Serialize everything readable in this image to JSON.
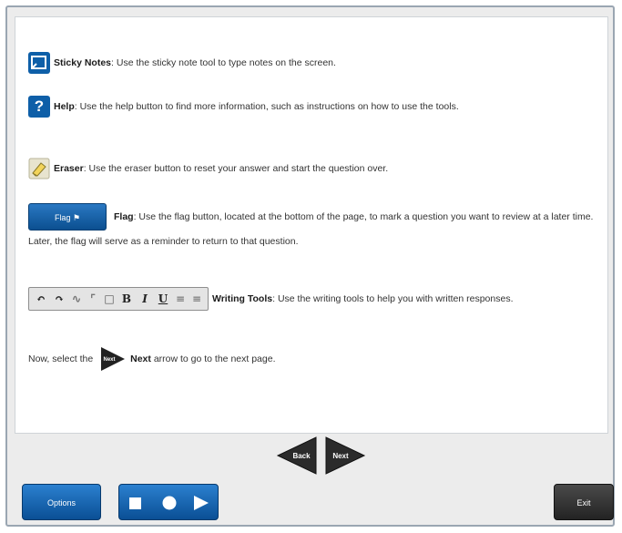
{
  "instructions": {
    "sticky": {
      "title": "Sticky Notes",
      "text": ": Use the sticky note tool to type notes on the screen."
    },
    "help": {
      "icon_label": "?",
      "title": "Help",
      "text": ": Use the help button to find more information, such as instructions on how to use the tools."
    },
    "eraser": {
      "title": "Eraser",
      "text": ": Use the eraser button to reset your answer and start the question over."
    },
    "flag": {
      "button_label": "Flag",
      "title": "Flag",
      "text": ": Use the flag button, located at the bottom of the page, to mark a question you want to review at a later time. Later, the flag will serve as a reminder to return to that question."
    },
    "writing": {
      "title": "Writing Tools",
      "text": ": Use the writing tools to help you with written responses.",
      "tools": [
        "undo",
        "redo",
        "B",
        "I",
        "U"
      ]
    },
    "next": {
      "before": "Now, select the",
      "icon_label": "Next",
      "title": "Next",
      "after": "arrow to go to the next page."
    }
  },
  "nav": {
    "back_label": "Back",
    "next_label": "Next"
  },
  "footer": {
    "options_label": "Options",
    "exit_label": "Exit"
  },
  "colors": {
    "accent_blue": "#0e5fa8",
    "dark_button": "#2b2b2b",
    "border": "#9aa6b2"
  }
}
